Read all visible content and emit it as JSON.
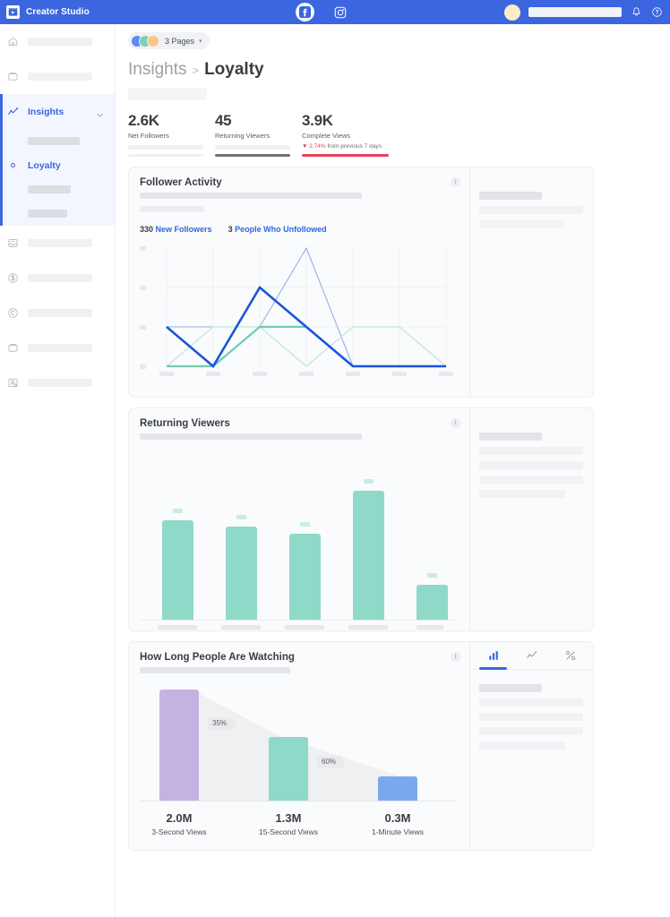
{
  "topbar": {
    "brand": "Creator Studio",
    "platforms": [
      {
        "name": "facebook-icon",
        "active": true
      },
      {
        "name": "instagram-icon",
        "active": false
      }
    ],
    "icons": [
      "bell-icon",
      "help-icon"
    ]
  },
  "sidebar": {
    "items": [
      {
        "icon": "home-icon",
        "label": "",
        "skeleton_width": 72
      },
      {
        "icon": "posts-icon",
        "label": "",
        "skeleton_width": 72
      },
      {
        "icon": "insights-icon",
        "label": "Insights",
        "active": true,
        "chevron": "chevron-down-icon"
      },
      {
        "icon": "inbox-icon",
        "label": "",
        "skeleton_width": 72
      },
      {
        "icon": "monetization-icon",
        "label": "",
        "skeleton_width": 72
      },
      {
        "icon": "copyright-icon",
        "label": "",
        "skeleton_width": 72
      },
      {
        "icon": "library-icon",
        "label": "",
        "skeleton_width": 72
      },
      {
        "icon": "audience-icon",
        "label": "",
        "skeleton_width": 72
      }
    ],
    "sub_items": [
      {
        "label": "",
        "skeleton_width": 58
      },
      {
        "label": "Loyalty",
        "active": true,
        "icon": "circle-dot-icon"
      },
      {
        "label": "",
        "skeleton_width": 48
      },
      {
        "label": "",
        "skeleton_width": 44
      }
    ]
  },
  "header": {
    "pages_pill": {
      "label": "3 Pages",
      "caret": "▾",
      "avatar_colors": [
        "#5a8def",
        "#7fcfb6",
        "#f7c68a"
      ]
    },
    "breadcrumb": {
      "parent": "Insights",
      "separator": ">",
      "current": "Loyalty"
    }
  },
  "stats": [
    {
      "value": "2.6K",
      "label": "Net Followers",
      "bar_color": "#f0f1f3"
    },
    {
      "value": "45",
      "label": "Returning Viewers",
      "bar_color": "#6d7074"
    },
    {
      "value": "3.9K",
      "label": "Complete Views",
      "bar_color": "#e8405a",
      "delta_arrow": "▼",
      "delta_value": "2.74%",
      "delta_suffix": "from previous 7 days"
    }
  ],
  "cards": [
    {
      "title": "Follower Activity",
      "info": "i",
      "legend": [
        {
          "num": "330",
          "label": "New Followers"
        },
        {
          "num": "3",
          "label": "People Who Unfollowed"
        }
      ]
    },
    {
      "title": "Returning Viewers",
      "info": "i"
    },
    {
      "title": "How Long People Are Watching",
      "info": "i",
      "tabs": [
        {
          "name": "bar-chart-tab",
          "active": true
        },
        {
          "name": "line-chart-tab",
          "active": false
        },
        {
          "name": "percent-tab",
          "active": false
        }
      ]
    }
  ],
  "chart_data": [
    {
      "type": "line",
      "title": "Follower Activity",
      "x": [
        1,
        2,
        3,
        4,
        5,
        6,
        7
      ],
      "ylim": [
        0,
        4
      ],
      "grid": true,
      "legend_position": "top-left",
      "series": [
        {
          "name": "New Followers",
          "color": "#1a56db",
          "width": 2.6,
          "values": [
            2,
            0,
            3,
            2,
            0,
            0,
            0
          ]
        },
        {
          "name": "New Followers (compare)",
          "color": "#8fb0f0",
          "width": 1,
          "values": [
            2,
            2,
            2,
            4,
            0,
            0,
            0
          ]
        },
        {
          "name": "People Who Unfollowed",
          "color": "#6fcbb4",
          "width": 2.2,
          "values": [
            0,
            0,
            2,
            2,
            0,
            0,
            0
          ]
        },
        {
          "name": "People Who Unfollowed (compare)",
          "color": "#bfe8dc",
          "width": 1,
          "values": [
            0,
            2,
            2,
            0,
            2,
            2,
            0
          ]
        }
      ],
      "ytick_count": 4,
      "xtick_count": 7
    },
    {
      "type": "bar",
      "title": "Returning Viewers",
      "categories": [
        "",
        "",
        "",
        "",
        ""
      ],
      "values": [
        76,
        70,
        64,
        100,
        27
      ],
      "ylim": [
        0,
        110
      ],
      "bar_color": "#8fd9c8",
      "chip_color": "#c9ece3"
    },
    {
      "type": "funnel",
      "title": "How Long People Are Watching",
      "steps": [
        {
          "value": "2.0M",
          "label": "3-Second Views",
          "height": 100,
          "color": "#c4b3e0"
        },
        {
          "value": "1.3M",
          "label": "15-Second Views",
          "height": 65,
          "color": "#8fd9c8"
        },
        {
          "value": "0.3M",
          "label": "1-Minute Views",
          "height": 22,
          "color": "#7aa8ee"
        }
      ],
      "dropoffs": [
        "35%",
        "60%"
      ]
    }
  ]
}
